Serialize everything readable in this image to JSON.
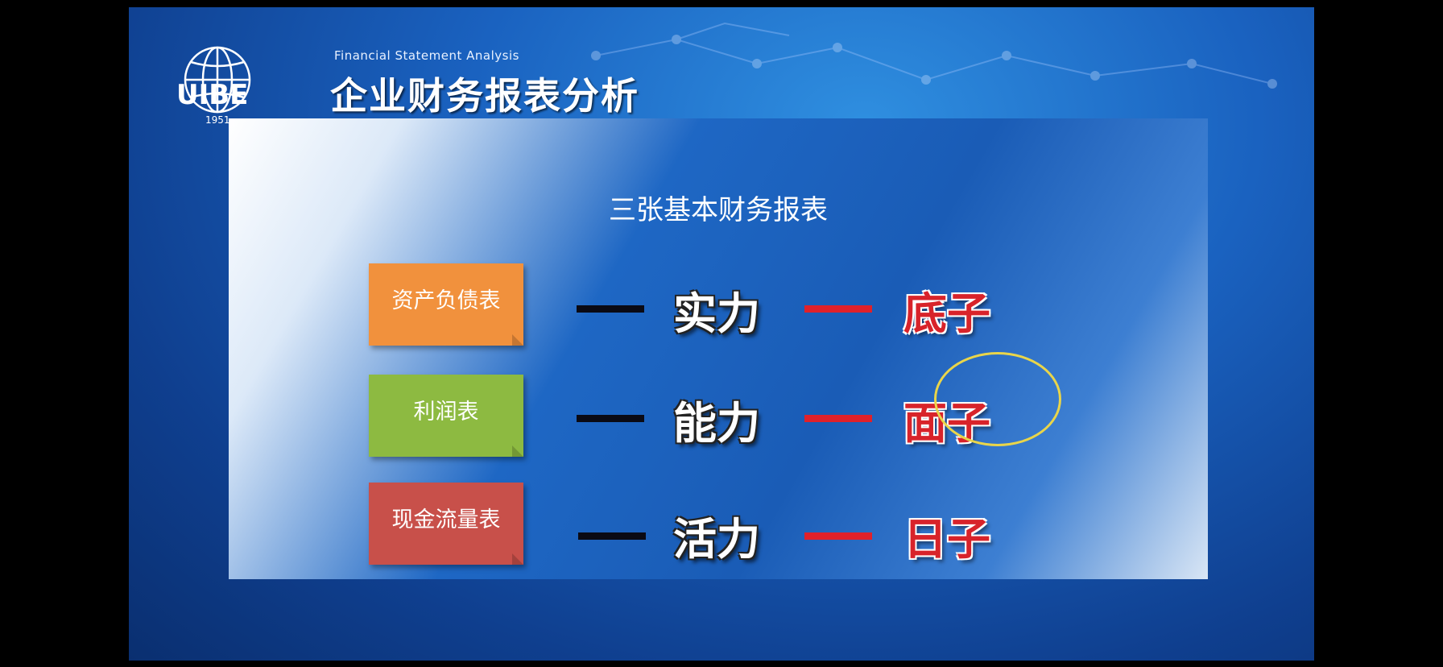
{
  "header": {
    "subtitle_en": "Financial Statement Analysis",
    "course_title": "企业财务报表分析",
    "logo": {
      "letters": "UIBE",
      "year": "1951",
      "icon": "globe-logo-icon"
    }
  },
  "panel": {
    "title": "三张基本财务报表",
    "rows": [
      {
        "statement": "资产负债表",
        "color": "#f1913d",
        "meaning": "实力",
        "nickname": "底子"
      },
      {
        "statement": "利润表",
        "color": "#8dba41",
        "meaning": "能力",
        "nickname": "面子",
        "highlighted": true
      },
      {
        "statement": "现金流量表",
        "color": "#c8504a",
        "meaning": "活力",
        "nickname": "日子"
      }
    ]
  },
  "colors": {
    "accent_red": "#d8232a",
    "ring": "#e9d54a"
  }
}
